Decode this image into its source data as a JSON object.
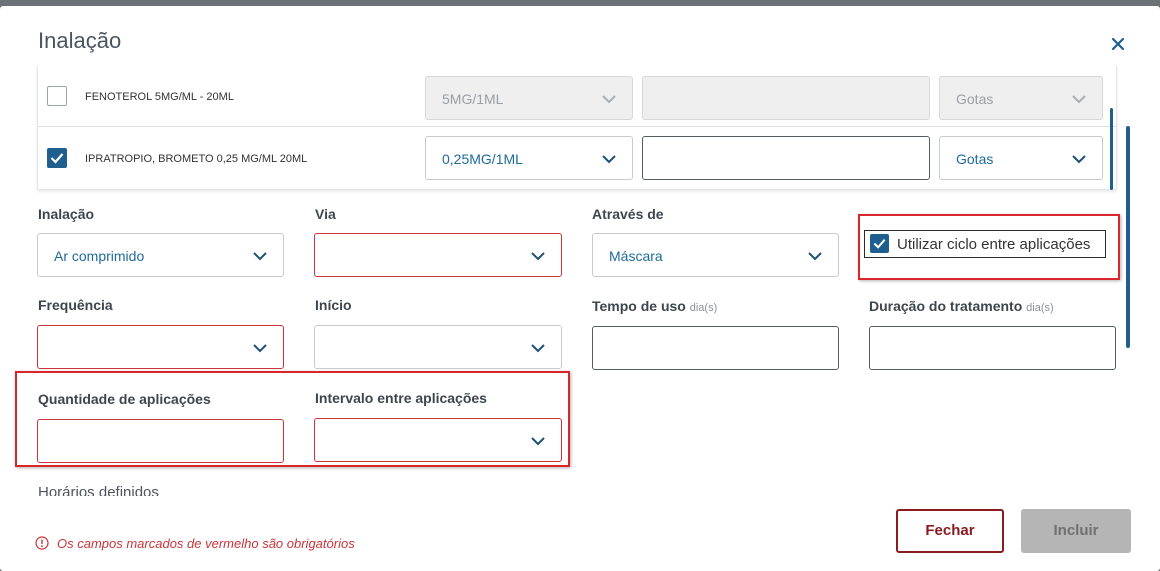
{
  "modal": {
    "title": "Inalação"
  },
  "medications": [
    {
      "name": "FENOTEROL 5MG/ML - 20ML",
      "checked": false,
      "dose": "5MG/1ML",
      "unit": "Gotas",
      "disabled": true
    },
    {
      "name": "IPRATROPIO, BROMETO 0,25 MG/ML 20ML",
      "checked": true,
      "dose": "0,25MG/1ML",
      "unit": "Gotas",
      "disabled": false
    }
  ],
  "form": {
    "inalacao": {
      "label": "Inalação",
      "value": "Ar comprimido"
    },
    "via": {
      "label": "Via",
      "value": ""
    },
    "atraves": {
      "label": "Através de",
      "value": "Máscara"
    },
    "ciclo": {
      "label": "Utilizar ciclo entre aplicações",
      "checked": true
    },
    "frequencia": {
      "label": "Frequência",
      "value": ""
    },
    "inicio": {
      "label": "Início",
      "value": ""
    },
    "tempo": {
      "label": "Tempo de uso",
      "unit": "dia(s)",
      "value": ""
    },
    "duracao": {
      "label": "Duração do tratamento",
      "unit": "dia(s)",
      "value": ""
    },
    "quantidade": {
      "label": "Quantidade de aplicações",
      "value": ""
    },
    "intervalo": {
      "label": "Intervalo entre aplicações",
      "value": ""
    },
    "horarios": {
      "label": "Horários definidos"
    }
  },
  "footer": {
    "required_note": "Os campos marcados de vermelho são obrigatórios",
    "close_label": "Fechar",
    "include_label": "Incluir"
  },
  "colors": {
    "primary": "#1e5f8f",
    "required": "#c8343a",
    "close_button": "#8a1c20",
    "highlight": "#d8262b"
  }
}
